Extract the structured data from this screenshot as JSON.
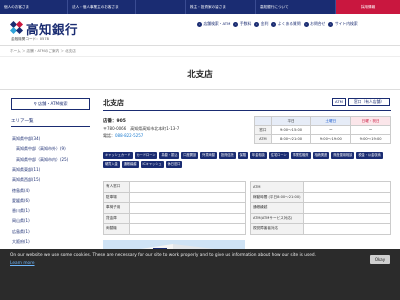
{
  "topnav": [
    {
      "label": "個人のお客さま",
      "cls": "w1"
    },
    {
      "label": "法人・個人事業主のお客さま",
      "cls": "w2"
    },
    {
      "label": "",
      "cls": "w3"
    },
    {
      "label": "株主・投資家の皆さま",
      "cls": "w4"
    },
    {
      "label": "高知銀行について",
      "cls": "w5"
    },
    {
      "label": "採用情報",
      "cls": "recruit"
    }
  ],
  "header": {
    "logo_text": "高知銀行",
    "bank_code": "金融機関コード：0578",
    "nav": [
      "店舗検索・ATM",
      "手数料",
      "金利",
      "よくある質問",
      "お問合せ",
      "サイト内検索"
    ]
  },
  "breadcrumb": "ホーム ＞ 店舗・ATMのご案内 ＞ 北支店",
  "page_title": "北支店",
  "sidebar": {
    "search_label": "店舗・ATM検索",
    "area_heading": "エリア一覧",
    "areas": [
      {
        "label": "高知県中部(34)",
        "sub": false
      },
      {
        "label": "高知県中部（高知市外）(9)",
        "sub": true
      },
      {
        "label": "高知県中部（高知市内）(25)",
        "sub": true
      },
      {
        "label": "高知県東部(11)",
        "sub": false
      },
      {
        "label": "高知県西部(15)",
        "sub": false
      },
      {
        "label": "徳島県(4)",
        "sub": false
      },
      {
        "label": "愛媛県(6)",
        "sub": false
      },
      {
        "label": "香川県(1)",
        "sub": false
      },
      {
        "label": "岡山県(1)",
        "sub": false
      },
      {
        "label": "広島県(1)",
        "sub": false
      },
      {
        "label": "大阪府(1)",
        "sub": false
      },
      {
        "label": "東京都(1)",
        "sub": false
      }
    ],
    "branch_heading": "ご相談窓口"
  },
  "branch": {
    "name": "北支店",
    "tag_atm": "ATM",
    "tag_window": "窓口（有人店舗）",
    "store_no": "店番：905",
    "address": "〒780-0066　高知県高知市北本町1-13-7",
    "phone_label": "電話：",
    "phone_number": "088-822-5257"
  },
  "hours": {
    "headers": [
      "",
      "平日",
      "土曜日",
      "日曜・祝日"
    ],
    "rows": [
      [
        "窓口",
        "9:00～15:00",
        "ー",
        "ー"
      ],
      [
        "ATM",
        "8:00～21:00",
        "9:00～19:00",
        "9:00～19:00"
      ]
    ]
  },
  "tags": [
    "キャッシュカード",
    "カードローン",
    "為替・振込",
    "口座開設",
    "外貨両替",
    "投資信託",
    "保険",
    "年金相談",
    "住宅ローン",
    "事業性融資",
    "相続関連",
    "資産運用相談",
    "税金・公金収納",
    "硬貨入金",
    "通帳繰越",
    "ICキャッシュ",
    "休日窓口"
  ],
  "info_left": [
    {
      "label": "有人窓口",
      "value": ""
    },
    {
      "label": "駐車場",
      "value": ""
    },
    {
      "label": "車椅子用",
      "value": ""
    },
    {
      "label": "貸金庫",
      "value": ""
    },
    {
      "label": "両替機",
      "value": ""
    }
  ],
  "info_right": [
    {
      "label": "ATM",
      "value": ""
    },
    {
      "label": "稼動時間\n(平日8:00～21:00)",
      "value": ""
    },
    {
      "label": "通帳繰越",
      "value": ""
    },
    {
      "label": "ATM(ATMサービス対応)",
      "value": ""
    },
    {
      "label": "視覚障害者対応",
      "value": ""
    }
  ],
  "cookie": {
    "text": "On our website we use some cookies. These are necessary for our site to work properly and to give us information about how our site is used.",
    "link": "Learn more",
    "button": "Okay"
  },
  "colors": {
    "brand": "#1a2c72",
    "accent": "#c9173f"
  }
}
